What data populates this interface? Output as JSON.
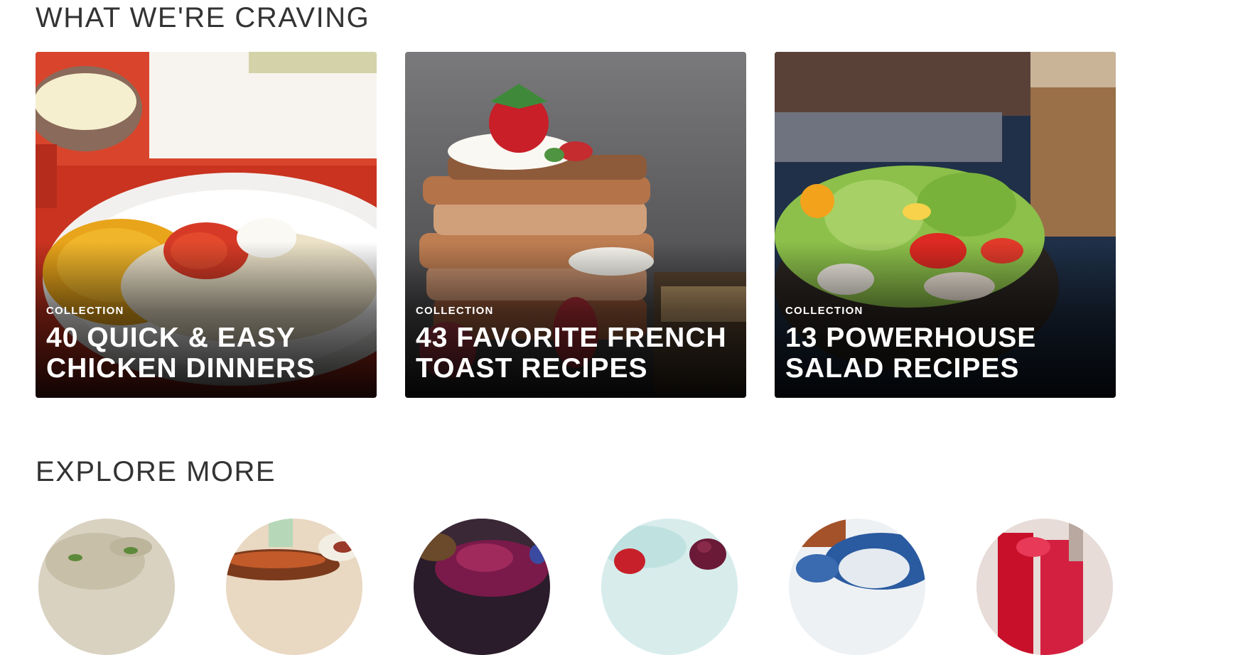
{
  "sections": {
    "craving_title": "WHAT WE'RE CRAVING",
    "explore_title": "EXPLORE MORE"
  },
  "cards": [
    {
      "kicker": "COLLECTION",
      "headline": "40 QUICK & EASY\nCHICKEN DINNERS"
    },
    {
      "kicker": "COLLECTION",
      "headline": "43 FAVORITE FRENCH\nTOAST RECIPES"
    },
    {
      "kicker": "COLLECTION",
      "headline": "13 POWERHOUSE\nSALAD RECIPES"
    }
  ],
  "colors": {
    "heading_text": "#333333",
    "card_text": "#ffffff"
  },
  "icons": {
    "explore_items": [
      "shredded-chicken-image",
      "baked-dish-image",
      "berry-skillet-image",
      "fruit-bowl-image",
      "blue-plate-dish-image",
      "red-drink-image"
    ]
  }
}
